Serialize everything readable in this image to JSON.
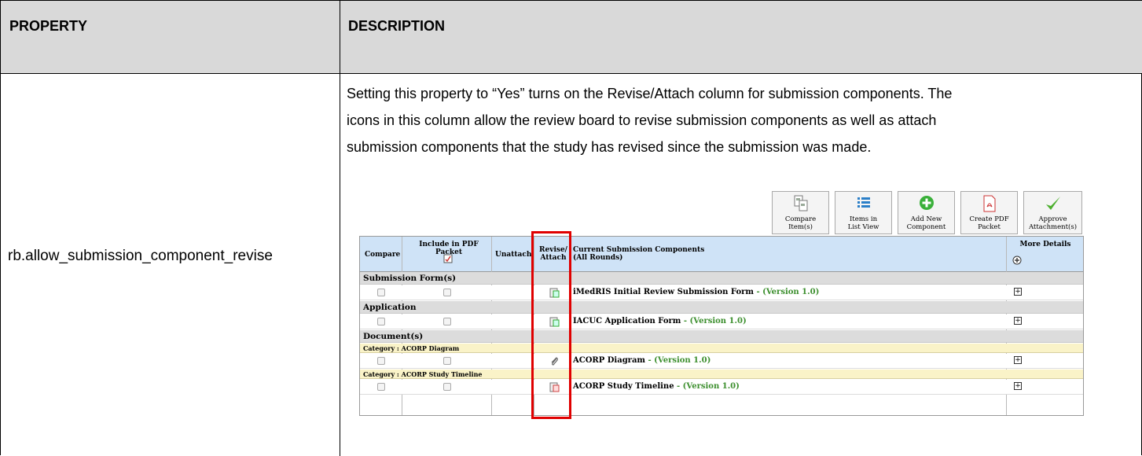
{
  "table": {
    "header": {
      "property": "PROPERTY",
      "description": "DESCRIPTION"
    },
    "property_name": "rb.allow_submission_component_revise",
    "description_lines": [
      "Setting this property to “Yes” turns on the Revise/Attach column for submission components. The",
      "icons in this column allow the review board to revise submission components as well as attach",
      "submission components that the study has revised since the submission was made."
    ]
  },
  "toolbar": {
    "buttons": [
      {
        "line1": "Compare",
        "line2": "Item(s)",
        "icon": "compare-icon"
      },
      {
        "line1": "Items in",
        "line2": "List View",
        "icon": "list-icon"
      },
      {
        "line1": "Add New",
        "line2": "Component",
        "icon": "plus-circle-icon"
      },
      {
        "line1": "Create PDF",
        "line2": "Packet",
        "icon": "pdf-icon"
      },
      {
        "line1": "Approve",
        "line2": "Attachment(s)",
        "icon": "checkmark-icon"
      }
    ]
  },
  "grid": {
    "columns": {
      "compare": "Compare",
      "include_pdf": "Include in PDF Packet",
      "unattach": "Unattach",
      "revise_1": "Revise/",
      "revise_2": "Attach",
      "current_1": "Current Submission Components",
      "current_2": "(All Rounds)",
      "more": "More Details"
    },
    "sections": [
      {
        "label": "Submission Form(s)"
      },
      {
        "label": "Application"
      },
      {
        "label": "Document(s)"
      }
    ],
    "categories": [
      {
        "label": "Category : ACORP Diagram"
      },
      {
        "label": "Category : ACORP Study Timeline"
      }
    ],
    "rows": [
      {
        "name": "iMedRIS Initial Review Submission Form",
        "version": " - (Version 1.0)"
      },
      {
        "name": "IACUC Application Form",
        "version": " - (Version 1.0)"
      },
      {
        "name": "ACORP Diagram",
        "version": " - (Version 1.0)"
      },
      {
        "name": "ACORP Study Timeline",
        "version": " - (Version 1.0)"
      }
    ]
  },
  "colors": {
    "header_bg": "#d9d9d9",
    "grid_header_bg": "#cfe3f7",
    "highlight": "#e00000",
    "version_green": "#3c8f2e",
    "category_bg": "#faf3c8"
  }
}
